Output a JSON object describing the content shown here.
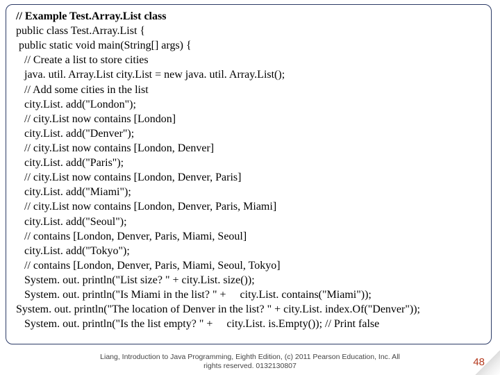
{
  "code": {
    "l0": "// Example Test.Array.List class",
    "l1": "public class Test.Array.List {",
    "l2": " public static void main(String[] args) {",
    "l3": "   // Create a list to store cities",
    "l4": "   java. util. Array.List city.List = new java. util. Array.List();",
    "l5": "   // Add some cities in the list",
    "l6": "   city.List. add(\"London\");",
    "l7": "   // city.List now contains [London]",
    "l8": "   city.List. add(\"Denver\");",
    "l9": "   // city.List now contains [London, Denver]",
    "l10": "   city.List. add(\"Paris\");",
    "l11": "   // city.List now contains [London, Denver, Paris]",
    "l12": "   city.List. add(\"Miami\");",
    "l13": "   // city.List now contains [London, Denver, Paris, Miami]",
    "l14": "   city.List. add(\"Seoul\");",
    "l15": "   // contains [London, Denver, Paris, Miami, Seoul]",
    "l16": "   city.List. add(\"Tokyo\");",
    "l17": "   // contains [London, Denver, Paris, Miami, Seoul, Tokyo]",
    "l18": "   System. out. println(\"List size? \" + city.List. size());",
    "l19": "   System. out. println(\"Is Miami in the list? \" +     city.List. contains(\"Miami\"));",
    "l20": "System. out. println(\"The location of Denver in the list? \" + city.List. index.Of(\"Denver\"));",
    "l21": "   System. out. println(\"Is the list empty? \" +     city.List. is.Empty()); // Print false"
  },
  "footer": {
    "line1": "Liang, Introduction to Java Programming, Eighth Edition, (c) 2011 Pearson Education, Inc. All",
    "line2": "rights reserved. 0132130807"
  },
  "page_number": "48"
}
